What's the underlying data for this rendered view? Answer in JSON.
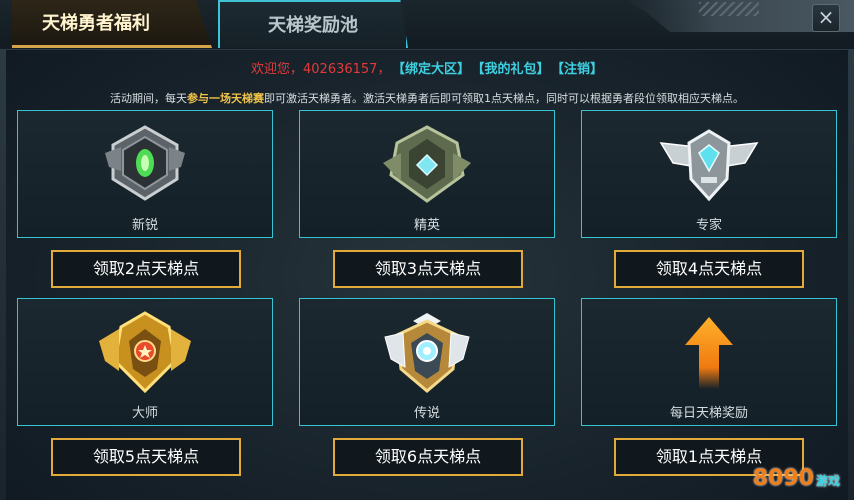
{
  "tabs": [
    {
      "label": "天梯勇者福利",
      "active": true
    },
    {
      "label": "天梯奖励池",
      "active": false
    }
  ],
  "close_glyph": "×",
  "welcome": {
    "greeting": "欢迎您，402636157，",
    "links": [
      "【绑定大区】",
      "【我的礼包】",
      "【注销】"
    ]
  },
  "notice": {
    "before": "活动期间，每天",
    "highlight": "参与一场天梯赛",
    "after": "即可激活天梯勇者。激活天梯勇者后即可领取1点天梯点，同时可以根据勇者段位领取相应天梯点。"
  },
  "tiers": [
    {
      "name": "新锐",
      "button": "领取2点天梯点",
      "icon": "rookie-emblem-icon"
    },
    {
      "name": "精英",
      "button": "领取3点天梯点",
      "icon": "elite-emblem-icon"
    },
    {
      "name": "专家",
      "button": "领取4点天梯点",
      "icon": "expert-emblem-icon"
    },
    {
      "name": "大师",
      "button": "领取5点天梯点",
      "icon": "master-emblem-icon"
    },
    {
      "name": "传说",
      "button": "领取6点天梯点",
      "icon": "legend-emblem-icon"
    },
    {
      "name": "每日天梯奖励",
      "button": "领取1点天梯点",
      "icon": "up-arrow-icon"
    }
  ],
  "watermark": {
    "brand": "8090",
    "sub": "游戏"
  },
  "colors": {
    "card_border": "#36c3d3",
    "button_border": "#e2a93b",
    "greeting": "#e33b3b",
    "link": "#3ecfe0",
    "highlight": "#f0c34a"
  }
}
